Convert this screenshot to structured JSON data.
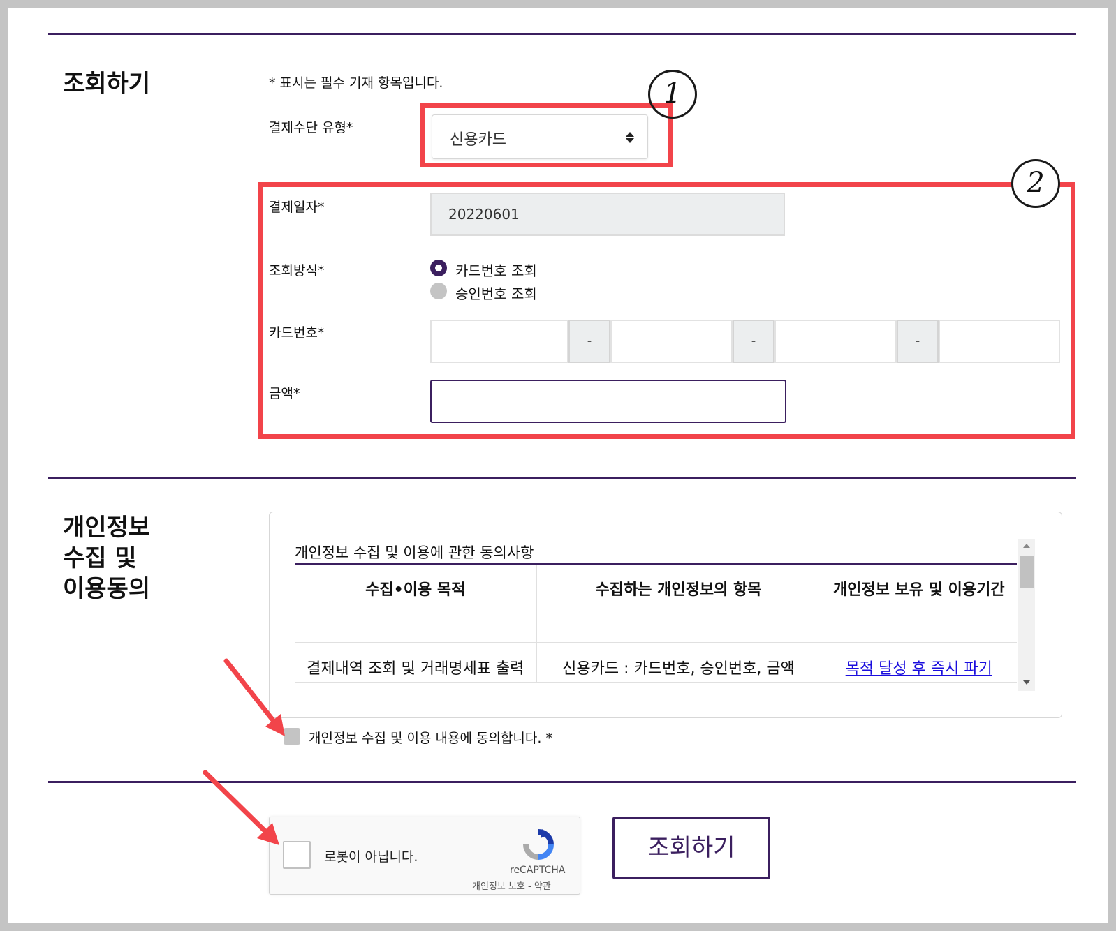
{
  "lookup_section": {
    "title": "조회하기",
    "required_note": "* 표시는 필수 기재 항목입니다.",
    "payment_type_label": "결제수단 유형*",
    "payment_type_value": "신용카드",
    "payment_date_label": "결제일자*",
    "payment_date_value": "20220601",
    "lookup_method_label": "조회방식*",
    "lookup_methods": [
      "카드번호 조회",
      "승인번호 조회"
    ],
    "lookup_method_selected": "카드번호 조회",
    "card_number_label": "카드번호*",
    "card_separator": "-",
    "amount_label": "금액*",
    "amount_value": ""
  },
  "annotations": {
    "marker_1": "1",
    "marker_2": "2"
  },
  "privacy_section": {
    "title_line1": "개인정보",
    "title_line2": "수집 및",
    "title_line3": "이용동의",
    "box_heading": "개인정보 수집 및 이용에 관한 동의사항",
    "columns": [
      "수집•이용 목적",
      "수집하는 개인정보의 항목",
      "개인정보 보유 및 이용기간"
    ],
    "row": [
      "결제내역 조회 및 거래명세표 출력",
      "신용카드 : 카드번호, 승인번호, 금액",
      "목적 달성 후 즉시 파기"
    ],
    "agree_label": "개인정보 수집 및 이용 내용에 동의합니다. *"
  },
  "captcha": {
    "label": "로봇이 아닙니다.",
    "brand": "reCAPTCHA",
    "links": "개인정보 보호 - 약관"
  },
  "submit_label": "조회하기",
  "colors": {
    "accent": "#3b1f5f",
    "annotation_red": "#f2444a",
    "link": "#1a0dde"
  }
}
